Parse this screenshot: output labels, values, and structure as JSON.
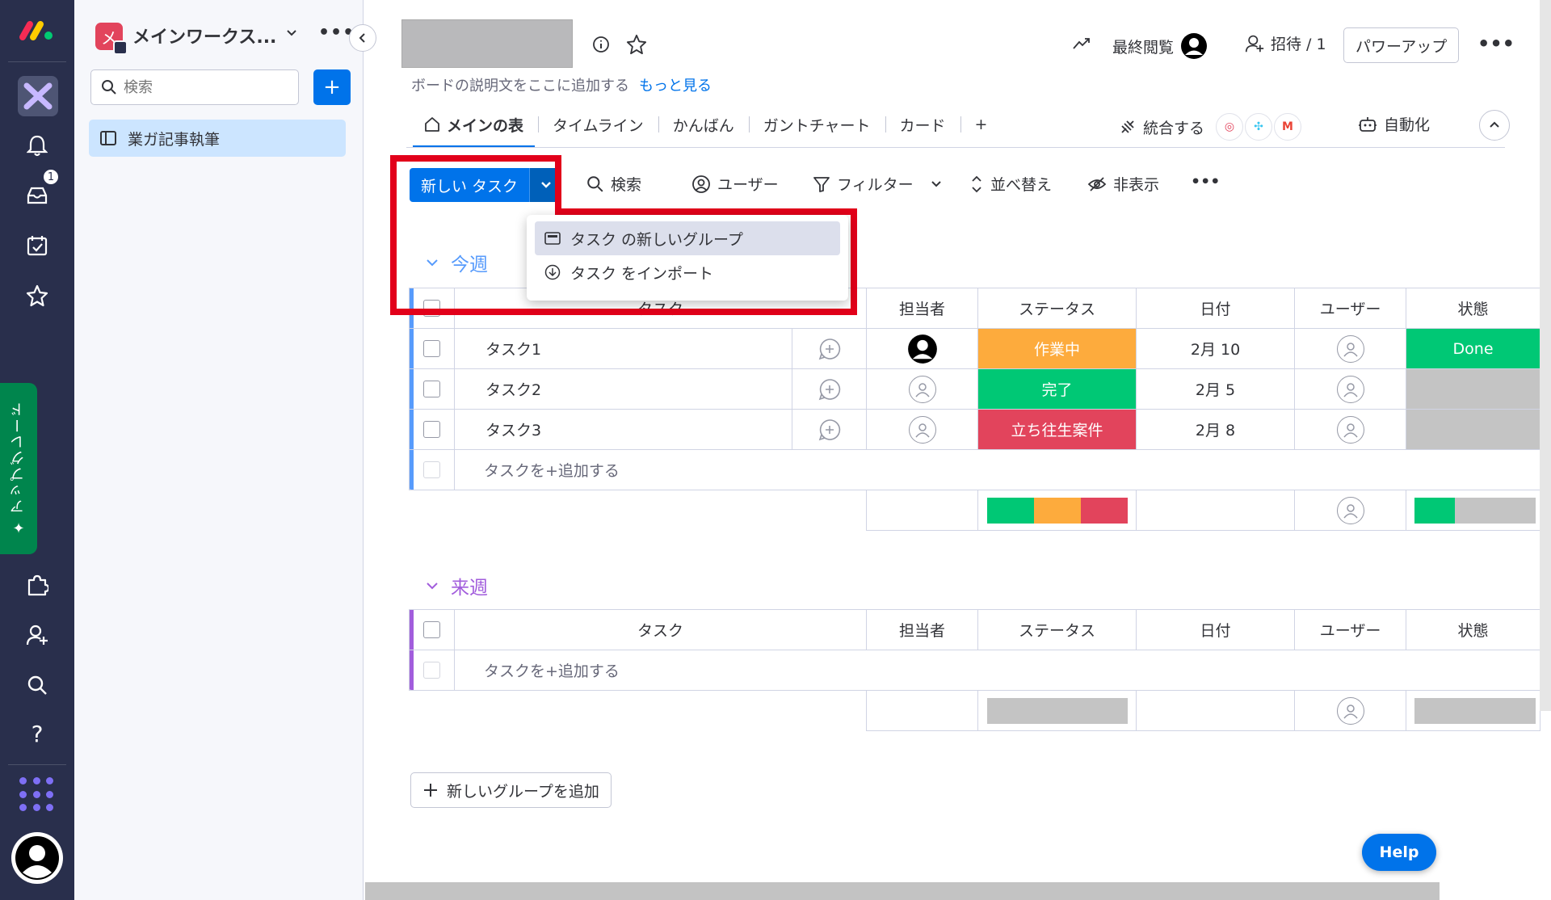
{
  "rail": {
    "inbox_badge": "1",
    "upgrade_label": "アップグレード",
    "icons": [
      "monday-logo-icon",
      "workspace-board-icon",
      "bell-icon",
      "inbox-icon",
      "my-work-icon",
      "favorites-star-icon",
      "apps-puzzle-icon",
      "invite-user-icon",
      "search-icon",
      "help-question-icon",
      "apps-grid-icon",
      "user-avatar-icon"
    ]
  },
  "sidebar": {
    "workspace_name": "メインワークス...",
    "workspace_initial": "メ",
    "search_placeholder": "検索",
    "add_label": "+",
    "items": [
      {
        "label": "業ガ記事執筆"
      }
    ]
  },
  "header": {
    "description": "ボードの説明文をここに追加する",
    "see_more": "もっと見る",
    "last_viewed": "最終閲覧",
    "invite": "招待 / 1",
    "power_up": "パワーアップ",
    "more": "•••"
  },
  "tabs": [
    {
      "label": "メインの表"
    },
    {
      "label": "タイムライン"
    },
    {
      "label": "かんばん"
    },
    {
      "label": "ガントチャート"
    },
    {
      "label": "カード"
    },
    {
      "label": "+"
    }
  ],
  "integrate_label": "統合する",
  "automate_label": "自動化",
  "toolbar": {
    "new_task": "新しい タスク",
    "search": "検索",
    "user": "ユーザー",
    "filter": "フィルター",
    "sort": "並べ替え",
    "hide": "非表示",
    "more": "•••"
  },
  "dropdown": {
    "items": [
      {
        "label": "タスク の新しいグループ"
      },
      {
        "label": "タスク をインポート"
      }
    ]
  },
  "columns": {
    "task": "タスク",
    "owner": "担当者",
    "status": "ステータス",
    "date": "日付",
    "user": "ユーザー",
    "state": "状態"
  },
  "groups": [
    {
      "title": "今週",
      "color": "#579bfc",
      "add_task": "タスクを+追加する",
      "rows": [
        {
          "name": "タスク1",
          "status": "作業中",
          "status_color": "#fdab3d",
          "date": "2月 10",
          "state": "Done",
          "state_color": "#00c875"
        },
        {
          "name": "タスク2",
          "status": "完了",
          "status_color": "#00c875",
          "date": "2月 5",
          "state": "",
          "state_color": "#c4c4c4"
        },
        {
          "name": "タスク3",
          "status": "立ち往生案件",
          "status_color": "#e2445c",
          "date": "2月 8",
          "state": "",
          "state_color": "#c4c4c4"
        }
      ]
    },
    {
      "title": "来週",
      "color": "#a25ddc",
      "add_task": "タスクを+追加する",
      "rows": []
    }
  ],
  "add_group": "新しいグループを追加",
  "help": "Help"
}
